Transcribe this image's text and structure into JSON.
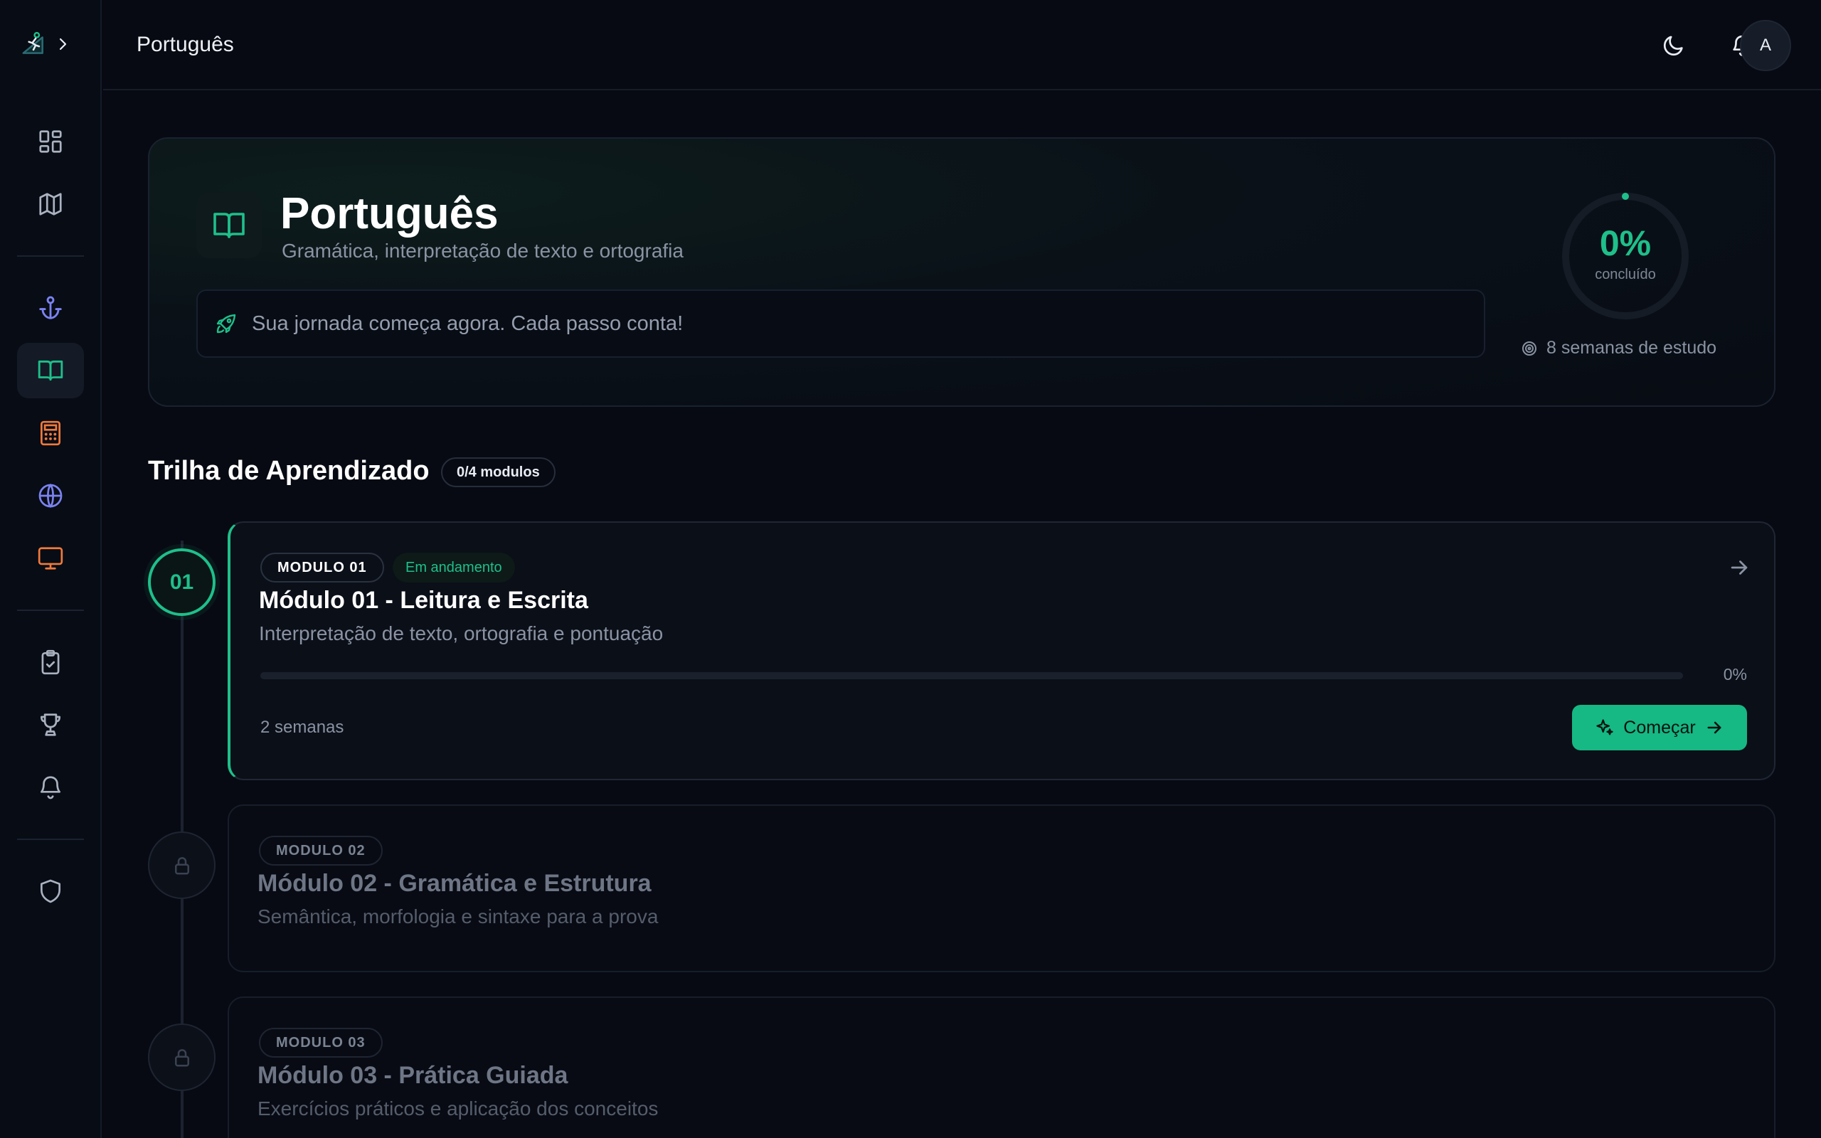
{
  "header": {
    "title": "Português",
    "theme_icon": "moon-icon",
    "notifications_icon": "bell-icon",
    "avatar_initial": "A"
  },
  "sidebar": {
    "logo_icon": "runner-logo-icon",
    "expand_icon": "chevron-right-icon",
    "items": [
      {
        "id": "dashboard",
        "icon": "grid-icon",
        "color": "#aab2c0"
      },
      {
        "id": "map",
        "icon": "map-icon",
        "color": "#aab2c0"
      },
      {
        "id": "anchor",
        "icon": "anchor-icon",
        "color": "#7b83f0"
      },
      {
        "id": "portugues",
        "icon": "book-icon",
        "color": "#1fbf8a",
        "active": true
      },
      {
        "id": "matematica",
        "icon": "calculator-icon",
        "color": "#f07a3c"
      },
      {
        "id": "ingles",
        "icon": "globe-icon",
        "color": "#7b83f0"
      },
      {
        "id": "informatica",
        "icon": "monitor-icon",
        "color": "#f07a3c"
      },
      {
        "id": "tarefas",
        "icon": "clipboard-check-icon",
        "color": "#aab2c0"
      },
      {
        "id": "conquistas",
        "icon": "trophy-icon",
        "color": "#aab2c0"
      },
      {
        "id": "notificacoes",
        "icon": "bell-icon",
        "color": "#aab2c0"
      },
      {
        "id": "seguranca",
        "icon": "shield-icon",
        "color": "#aab2c0"
      }
    ]
  },
  "hero": {
    "title": "Português",
    "subtitle": "Gramática, interpretação de texto e ortografia",
    "banner_text": "Sua jornada começa agora. Cada passo conta!",
    "progress_percent": 0,
    "progress_label": "0%",
    "progress_caption": "concluído",
    "weeks_text": "8 semanas de estudo"
  },
  "trail": {
    "title": "Trilha de Aprendizado",
    "badge": "0/4 modulos",
    "modules": [
      {
        "number": "01",
        "tag": "MODULO 01",
        "status": "Em andamento",
        "title": "Módulo 01 - Leitura e Escrita",
        "description": "Interpretação de texto, ortografia e pontuação",
        "progress_percent": 0,
        "progress_label": "0%",
        "duration": "2 semanas",
        "cta": "Começar",
        "locked": false
      },
      {
        "tag": "MODULO 02",
        "title": "Módulo 02 - Gramática e Estrutura",
        "description": "Semântica, morfologia e sintaxe para a prova",
        "locked": true
      },
      {
        "tag": "MODULO 03",
        "title": "Módulo 03 - Prática Guiada",
        "description": "Exercícios práticos e aplicação dos conceitos",
        "locked": true
      }
    ]
  },
  "colors": {
    "accent": "#1fbf8a",
    "background": "#070a12"
  }
}
